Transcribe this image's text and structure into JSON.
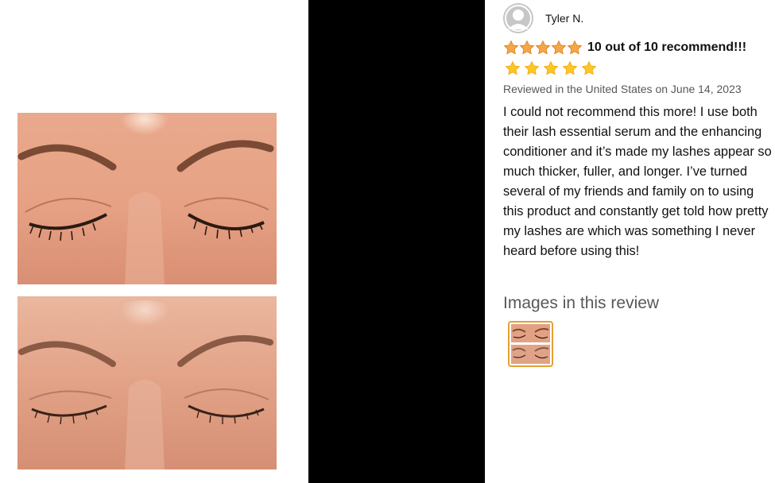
{
  "viewer": {
    "images": [
      "before-eyes-photo",
      "after-eyes-photo"
    ]
  },
  "review": {
    "reviewer_name": "Tyler N.",
    "rating": 5,
    "rating_max": 5,
    "headline": "10 out of 10 recommend!!!",
    "meta": "Reviewed in the United States on June 14, 2023",
    "body": "I could not recommend this more! I use both their lash essential serum and the enhancing conditioner and it’s made my lashes appear so much thicker, fuller, and longer. I’ve turned several of my friends and family on to using this product and constantly get told how pretty my lashes are which was something I never heard before using this!",
    "images_heading": "Images in this review"
  },
  "colors": {
    "star": "#f3a847",
    "thumb_border": "#e4a033",
    "muted_text": "#565959",
    "text": "#0f1111",
    "panel": "#000000"
  },
  "icons": {
    "avatar": "user-avatar-icon",
    "star": "star-icon"
  }
}
